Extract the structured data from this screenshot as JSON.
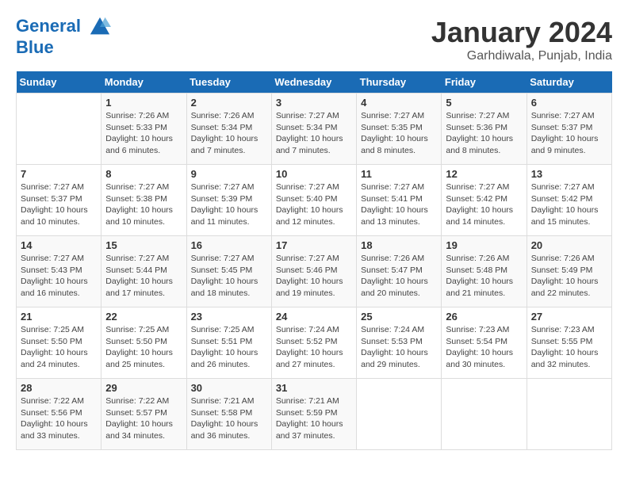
{
  "header": {
    "logo_line1": "General",
    "logo_line2": "Blue",
    "month_title": "January 2024",
    "location": "Garhdiwala, Punjab, India"
  },
  "weekdays": [
    "Sunday",
    "Monday",
    "Tuesday",
    "Wednesday",
    "Thursday",
    "Friday",
    "Saturday"
  ],
  "weeks": [
    [
      {
        "day": "",
        "info": ""
      },
      {
        "day": "1",
        "info": "Sunrise: 7:26 AM\nSunset: 5:33 PM\nDaylight: 10 hours\nand 6 minutes."
      },
      {
        "day": "2",
        "info": "Sunrise: 7:26 AM\nSunset: 5:34 PM\nDaylight: 10 hours\nand 7 minutes."
      },
      {
        "day": "3",
        "info": "Sunrise: 7:27 AM\nSunset: 5:34 PM\nDaylight: 10 hours\nand 7 minutes."
      },
      {
        "day": "4",
        "info": "Sunrise: 7:27 AM\nSunset: 5:35 PM\nDaylight: 10 hours\nand 8 minutes."
      },
      {
        "day": "5",
        "info": "Sunrise: 7:27 AM\nSunset: 5:36 PM\nDaylight: 10 hours\nand 8 minutes."
      },
      {
        "day": "6",
        "info": "Sunrise: 7:27 AM\nSunset: 5:37 PM\nDaylight: 10 hours\nand 9 minutes."
      }
    ],
    [
      {
        "day": "7",
        "info": "Sunrise: 7:27 AM\nSunset: 5:37 PM\nDaylight: 10 hours\nand 10 minutes."
      },
      {
        "day": "8",
        "info": "Sunrise: 7:27 AM\nSunset: 5:38 PM\nDaylight: 10 hours\nand 10 minutes."
      },
      {
        "day": "9",
        "info": "Sunrise: 7:27 AM\nSunset: 5:39 PM\nDaylight: 10 hours\nand 11 minutes."
      },
      {
        "day": "10",
        "info": "Sunrise: 7:27 AM\nSunset: 5:40 PM\nDaylight: 10 hours\nand 12 minutes."
      },
      {
        "day": "11",
        "info": "Sunrise: 7:27 AM\nSunset: 5:41 PM\nDaylight: 10 hours\nand 13 minutes."
      },
      {
        "day": "12",
        "info": "Sunrise: 7:27 AM\nSunset: 5:42 PM\nDaylight: 10 hours\nand 14 minutes."
      },
      {
        "day": "13",
        "info": "Sunrise: 7:27 AM\nSunset: 5:42 PM\nDaylight: 10 hours\nand 15 minutes."
      }
    ],
    [
      {
        "day": "14",
        "info": "Sunrise: 7:27 AM\nSunset: 5:43 PM\nDaylight: 10 hours\nand 16 minutes."
      },
      {
        "day": "15",
        "info": "Sunrise: 7:27 AM\nSunset: 5:44 PM\nDaylight: 10 hours\nand 17 minutes."
      },
      {
        "day": "16",
        "info": "Sunrise: 7:27 AM\nSunset: 5:45 PM\nDaylight: 10 hours\nand 18 minutes."
      },
      {
        "day": "17",
        "info": "Sunrise: 7:27 AM\nSunset: 5:46 PM\nDaylight: 10 hours\nand 19 minutes."
      },
      {
        "day": "18",
        "info": "Sunrise: 7:26 AM\nSunset: 5:47 PM\nDaylight: 10 hours\nand 20 minutes."
      },
      {
        "day": "19",
        "info": "Sunrise: 7:26 AM\nSunset: 5:48 PM\nDaylight: 10 hours\nand 21 minutes."
      },
      {
        "day": "20",
        "info": "Sunrise: 7:26 AM\nSunset: 5:49 PM\nDaylight: 10 hours\nand 22 minutes."
      }
    ],
    [
      {
        "day": "21",
        "info": "Sunrise: 7:25 AM\nSunset: 5:50 PM\nDaylight: 10 hours\nand 24 minutes."
      },
      {
        "day": "22",
        "info": "Sunrise: 7:25 AM\nSunset: 5:50 PM\nDaylight: 10 hours\nand 25 minutes."
      },
      {
        "day": "23",
        "info": "Sunrise: 7:25 AM\nSunset: 5:51 PM\nDaylight: 10 hours\nand 26 minutes."
      },
      {
        "day": "24",
        "info": "Sunrise: 7:24 AM\nSunset: 5:52 PM\nDaylight: 10 hours\nand 27 minutes."
      },
      {
        "day": "25",
        "info": "Sunrise: 7:24 AM\nSunset: 5:53 PM\nDaylight: 10 hours\nand 29 minutes."
      },
      {
        "day": "26",
        "info": "Sunrise: 7:23 AM\nSunset: 5:54 PM\nDaylight: 10 hours\nand 30 minutes."
      },
      {
        "day": "27",
        "info": "Sunrise: 7:23 AM\nSunset: 5:55 PM\nDaylight: 10 hours\nand 32 minutes."
      }
    ],
    [
      {
        "day": "28",
        "info": "Sunrise: 7:22 AM\nSunset: 5:56 PM\nDaylight: 10 hours\nand 33 minutes."
      },
      {
        "day": "29",
        "info": "Sunrise: 7:22 AM\nSunset: 5:57 PM\nDaylight: 10 hours\nand 34 minutes."
      },
      {
        "day": "30",
        "info": "Sunrise: 7:21 AM\nSunset: 5:58 PM\nDaylight: 10 hours\nand 36 minutes."
      },
      {
        "day": "31",
        "info": "Sunrise: 7:21 AM\nSunset: 5:59 PM\nDaylight: 10 hours\nand 37 minutes."
      },
      {
        "day": "",
        "info": ""
      },
      {
        "day": "",
        "info": ""
      },
      {
        "day": "",
        "info": ""
      }
    ]
  ]
}
